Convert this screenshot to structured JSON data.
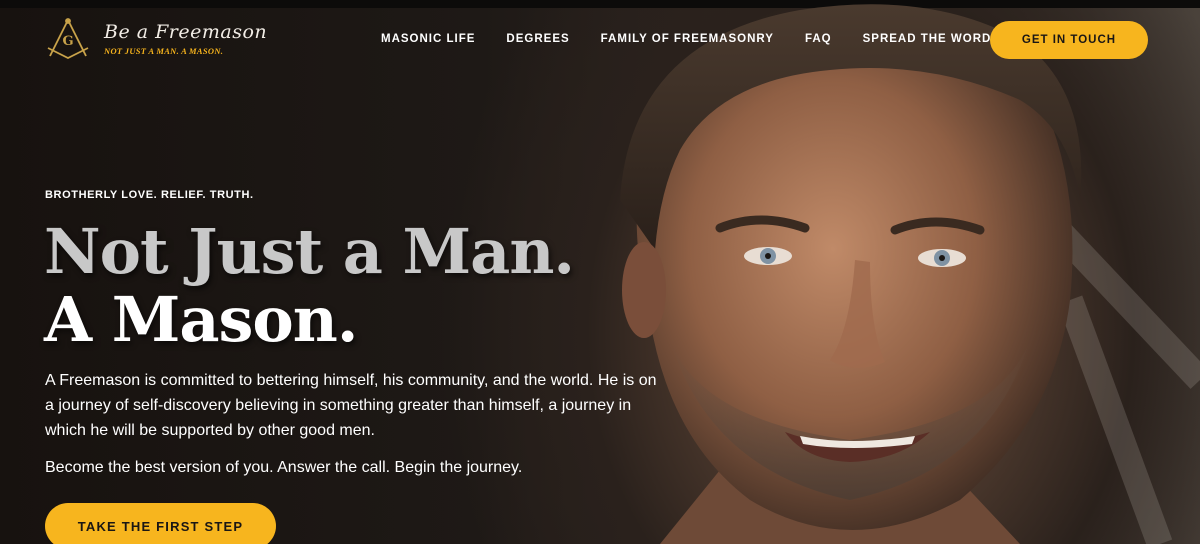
{
  "brand": {
    "name": "Be a Freemason",
    "tagline": "NOT JUST A MAN. A MASON.",
    "logo_letter": "G",
    "colors": {
      "accent": "#f7b51e",
      "text": "#ffffff",
      "background": "#1a1614"
    }
  },
  "nav": {
    "items": [
      {
        "label": "MASONIC LIFE"
      },
      {
        "label": "DEGREES"
      },
      {
        "label": "FAMILY OF FREEMASONRY"
      },
      {
        "label": "FAQ"
      },
      {
        "label": "SPREAD THE WORD"
      }
    ],
    "cta_label": "GET IN TOUCH"
  },
  "hero": {
    "eyebrow": "BROTHERLY LOVE. RELIEF. TRUTH.",
    "headline_line1": "Not Just a Man.",
    "headline_line2": "A Mason.",
    "body": "A Freemason is committed to bettering himself, his community, and the world. He is on a journey of self-discovery believing in something greater than himself, a journey in which he will be supported by other good men.",
    "body2": "Become the best version of you. Answer the call. Begin the journey.",
    "cta_label": "TAKE THE FIRST STEP"
  }
}
